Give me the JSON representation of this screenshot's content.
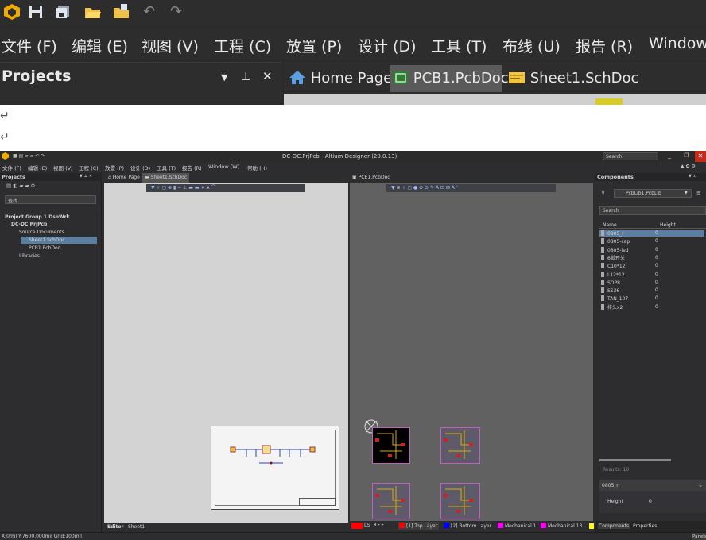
{
  "zoom": {
    "menu": [
      "文件 (F)",
      "编辑 (E)",
      "视图 (V)",
      "工程 (C)",
      "放置 (P)",
      "设计 (D)",
      "工具 (T)",
      "布线 (U)",
      "报告 (R)",
      "Window"
    ],
    "panel_title": "Projects",
    "tabs": [
      "Home Page",
      "PCB1.PcbDoc",
      "Sheet1.SchDoc"
    ]
  },
  "app": {
    "window_title": "DC-DC.PrjPcb - Altium Designer (20.0.13)",
    "search_label": "Search",
    "menu": [
      "文件 (F)",
      "编辑 (E)",
      "视图 (V)",
      "工程 (C)",
      "放置 (P)",
      "设计 (D)",
      "工具 (T)",
      "报告 (R)",
      "Window (W)",
      "帮助 (H)"
    ],
    "projects": {
      "title": "Projects",
      "search_placeholder": "查找",
      "tree": [
        "Project Group 1.DsnWrk",
        "DC-DC.PrjPcb",
        "Source Documents",
        "Sheet1.SchDoc",
        "PCB1.PcbDoc",
        "Libraries"
      ]
    },
    "sch_tabs": [
      "Home Page",
      "Sheet1.SchDoc"
    ],
    "pcb_tab": "PCB1.PcbDoc",
    "bottom_tabs": [
      "Editor",
      "Sheet1"
    ],
    "layers": {
      "ls": "LS",
      "items": [
        {
          "label": "[1] Top Layer",
          "color": "#ff0000"
        },
        {
          "label": "[2] Bottom Layer",
          "color": "#0000ff"
        },
        {
          "label": "Mechanical 1",
          "color": "#ff00ff"
        },
        {
          "label": "Mechanical 13",
          "color": "#ff00ff"
        },
        {
          "label": "Components",
          "color": "#ffff00"
        }
      ]
    },
    "components": {
      "title": "Components",
      "library": "PcbLib1.PcbLib",
      "search_placeholder": "Search",
      "col_name": "Name",
      "col_height": "Height",
      "rows": [
        {
          "name": "0805_r",
          "height": "0"
        },
        {
          "name": "0805-cap",
          "height": "0"
        },
        {
          "name": "0805-led",
          "height": "0"
        },
        {
          "name": "6脚开关",
          "height": "0"
        },
        {
          "name": "C10*12",
          "height": "0"
        },
        {
          "name": "L12*12",
          "height": "0"
        },
        {
          "name": "SOP8",
          "height": "0"
        },
        {
          "name": "SS36",
          "height": "0"
        },
        {
          "name": "TAN_107",
          "height": "0"
        },
        {
          "name": "排头x2",
          "height": "0"
        }
      ],
      "results": "Results: 10",
      "selected": "0805_r",
      "detail_label": "Height",
      "detail_value": "0",
      "bottom_tabs": [
        "Components",
        "Properties"
      ]
    },
    "status": "X:0mil Y:7600.000mil   Grid:100mil",
    "panels_btn": "Panels"
  },
  "colors": {
    "accent": "#6e8db0",
    "top_layer": "#ff0000",
    "pcb_bg": "#616161",
    "sch_bg": "#d3d3d3"
  }
}
